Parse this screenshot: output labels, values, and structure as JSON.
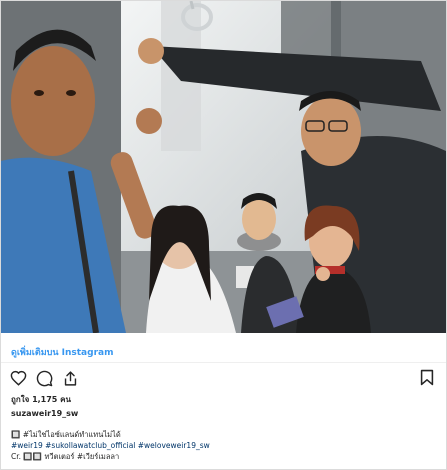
{
  "post": {
    "view_more_label": "ดูเพิ่มเติมบน Instagram",
    "likes_text": "ถูกใจ 1,175 คน",
    "username": "suzaweir19_sw",
    "caption_line1": "🔲 #ไม่ใช่ไอซ์แลนด์ทำแทนไม่ได้",
    "caption_line2": "#weir19 #sukollawatclub_official #weloveweir19_sw",
    "caption_line3": "Cr. 🔲🔲 ทวีตเตอร์ #เวียร์เมลลา"
  },
  "icons": {
    "like": "heart-icon",
    "comment": "comment-icon",
    "share": "share-icon",
    "save": "bookmark-icon"
  },
  "colors": {
    "link": "#3897f0",
    "hashtag": "#003569",
    "text": "#262626",
    "border": "#dbdbdb"
  }
}
